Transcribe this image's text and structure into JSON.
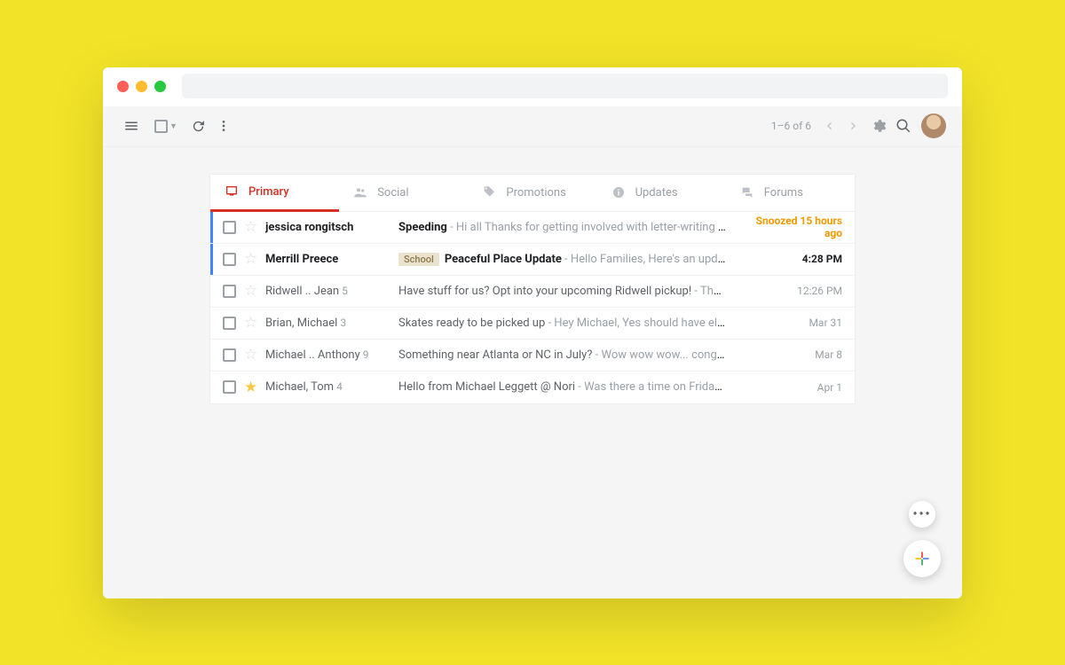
{
  "toolbar": {
    "page_info": "1–6 of 6"
  },
  "tabs": [
    {
      "label": "Primary",
      "active": true
    },
    {
      "label": "Social"
    },
    {
      "label": "Promotions"
    },
    {
      "label": "Updates"
    },
    {
      "label": "Forums"
    }
  ],
  "emails": [
    {
      "sender": "jessica rongitsch",
      "subject": "Speeding",
      "snippet": "Hi all Thanks for getting involved with letter-writing to see if it hel…",
      "time": "Snoozed 15 hours ago",
      "unread": true,
      "starred": false,
      "snoozed": true
    },
    {
      "sender": "Merrill Preece",
      "label": "School",
      "subject": "Peaceful Place Update",
      "snippet": "Hello Families, Here's an update on all we've been up to…",
      "time": "4:28 PM",
      "unread": true,
      "starred": false
    },
    {
      "sender": "Ridwell .. Jean",
      "count": "5",
      "subject": "Have stuff for us? Opt into your upcoming Ridwell pickup!",
      "snippet": "Thanks, Michael, I had forgot…",
      "time": "12:26 PM",
      "starred": false
    },
    {
      "sender": "Brian, Michael",
      "count": "3",
      "subject": "Skates ready to be picked up",
      "snippet": "Hey Michael, Yes should have elbow pads and knee pads, …",
      "time": "Mar 31",
      "starred": false
    },
    {
      "sender": "Michael .. Anthony",
      "count": "9",
      "subject": "Something near Atlanta or NC in July?",
      "snippet": "Wow wow wow... congrats! Sounds like you're pl…",
      "time": "Mar 8",
      "starred": false
    },
    {
      "sender": "Michael, Tom",
      "count": "4",
      "subject": "Hello from Michael Leggett @ Nori",
      "snippet": "Was there a time on Friday that works for you?",
      "time": "Apr 1",
      "starred": true
    }
  ]
}
